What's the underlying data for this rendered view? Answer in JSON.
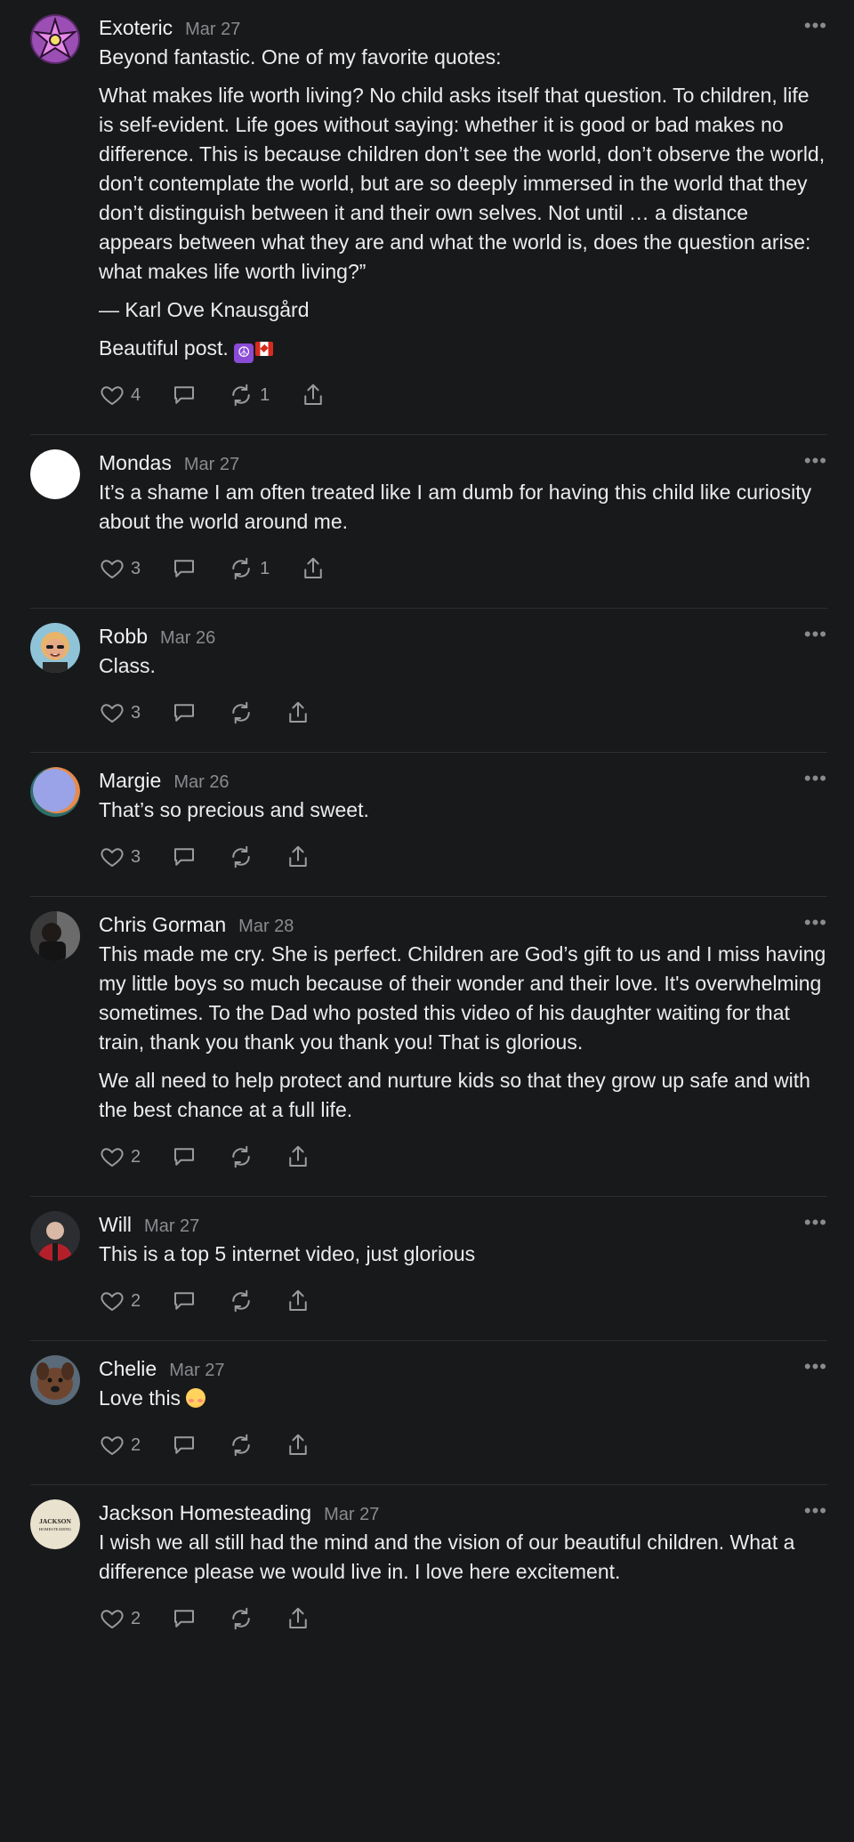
{
  "comments": [
    {
      "name": "Exoteric",
      "date": "Mar 27",
      "avatar": "pink-star-avatar",
      "paras": [
        "Beyond fantastic. One of my favorite quotes:",
        "What makes life worth living? No child asks itself that question. To children, life is self-evident. Life goes without saying: whether it is good or bad makes no difference. This is because children don’t see the world, don’t observe the world, don’t contemplate the world, but are so deeply immersed in the world that they don’t distinguish between it and their own selves. Not until … a distance appears between what they are and what the world is, does the question arise: what makes life worth living?”",
        "— Karl Ove Knausgård",
        "Beautiful post."
      ],
      "likes": "4",
      "restacks": "1"
    },
    {
      "name": "Mondas",
      "date": "Mar 27",
      "paras": [
        "It’s a shame I am often treated like I am dumb for having this child like curiosity about the world around me."
      ],
      "likes": "3",
      "restacks": "1"
    },
    {
      "name": "Robb",
      "date": "Mar 26",
      "paras": [
        "Class."
      ],
      "likes": "3",
      "restacks": ""
    },
    {
      "name": "Margie",
      "date": "Mar 26",
      "paras": [
        "That’s so precious and sweet."
      ],
      "likes": "3",
      "restacks": ""
    },
    {
      "name": "Chris Gorman",
      "date": "Mar 28",
      "paras": [
        "This made me cry. She is perfect. Children are God’s gift to us and I miss having my little boys so much because of their wonder and their love. It's overwhelming sometimes. To the Dad who posted this video of his daughter waiting for that train, thank you thank you thank you! That is glorious.",
        "We all need to help protect and nurture kids so that they grow up safe and with the best chance at a full life."
      ],
      "likes": "2",
      "restacks": ""
    },
    {
      "name": "Will",
      "date": "Mar 27",
      "paras": [
        "This is a top 5 internet video, just glorious"
      ],
      "likes": "2",
      "restacks": ""
    },
    {
      "name": "Chelie",
      "date": "Mar 27",
      "paras": [
        "Love this"
      ],
      "likes": "2",
      "restacks": ""
    },
    {
      "name": "Jackson Homesteading",
      "date": "Mar 27",
      "avatar_text": [
        "JACKSON",
        "HOMESTEADING"
      ],
      "paras": [
        "I wish we all still had the mind and the vision of our beautiful children. What a difference please we would live in. I love here excitement."
      ],
      "likes": "2",
      "restacks": ""
    }
  ],
  "ui": {
    "more_label": "•••",
    "peace_glyph": "☮",
    "colors": {
      "background": "#18191b",
      "text": "#ececec",
      "muted": "#8a8b8e",
      "divider": "#2e2f32"
    }
  }
}
